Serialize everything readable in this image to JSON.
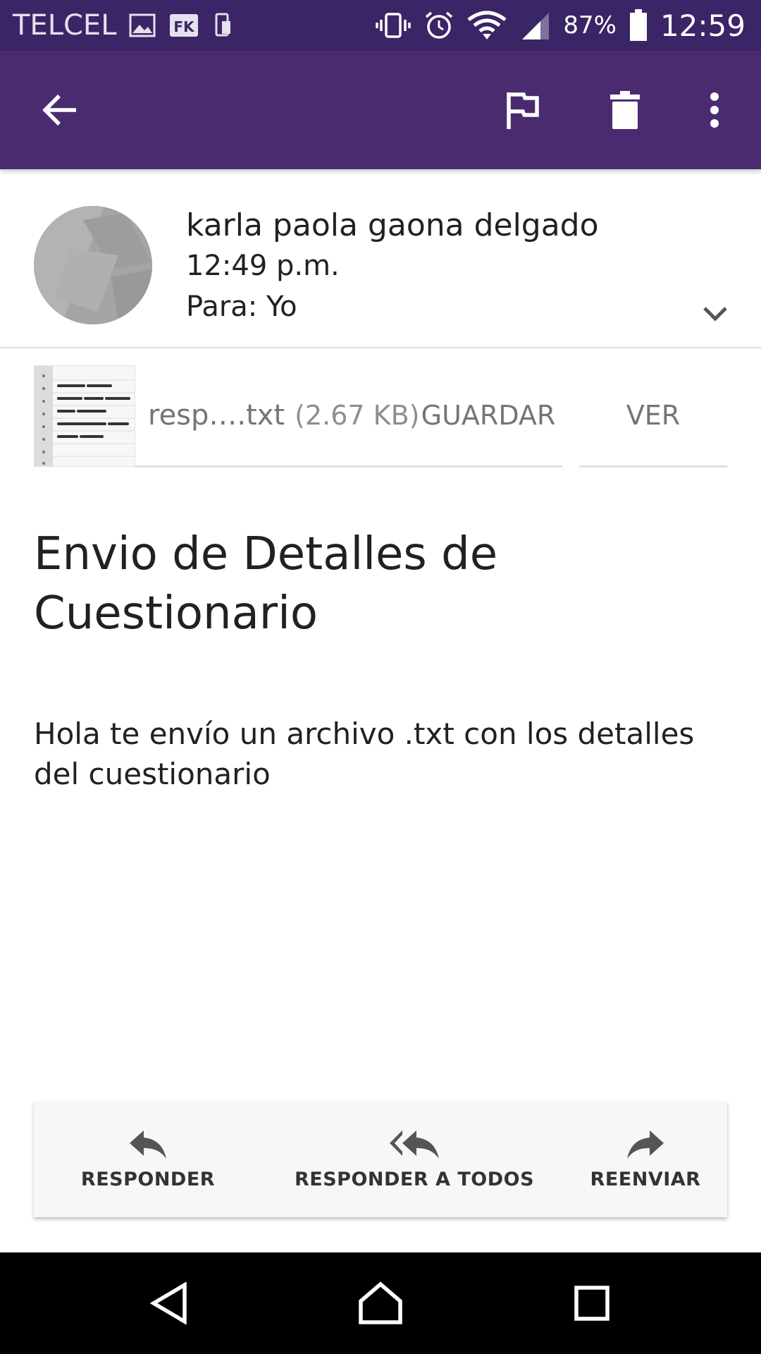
{
  "status_bar": {
    "carrier": "TELCEL",
    "battery_percent": "87%",
    "clock": "12:59",
    "icons": [
      "gallery-icon",
      "fk-app-icon",
      "phone-transfer-icon",
      "vibrate-icon",
      "alarm-icon",
      "wifi-icon",
      "signal-icon",
      "battery-icon"
    ]
  },
  "app_bar": {
    "actions": [
      "back-arrow-icon",
      "flag-icon",
      "delete-icon",
      "more-vert-icon"
    ],
    "color": "#4b2b70"
  },
  "message": {
    "sender_name": "karla paola gaona delgado",
    "time": "12:49 p.m.",
    "to": "Para: Yo",
    "subject": "Envio de Detalles de Cuestionario",
    "body": "Hola te envío un archivo .txt con los detalles del cuestionario"
  },
  "attachment": {
    "name": "resp….txt",
    "size": "(2.67 KB)",
    "save_label": "GUARDAR",
    "view_label": "VER"
  },
  "reply_actions": {
    "reply": "RESPONDER",
    "reply_all": "RESPONDER A TODOS",
    "forward": "REENVIAR"
  },
  "nav_bar": {
    "buttons": [
      "nav-back-icon",
      "nav-home-icon",
      "nav-recents-icon"
    ]
  }
}
